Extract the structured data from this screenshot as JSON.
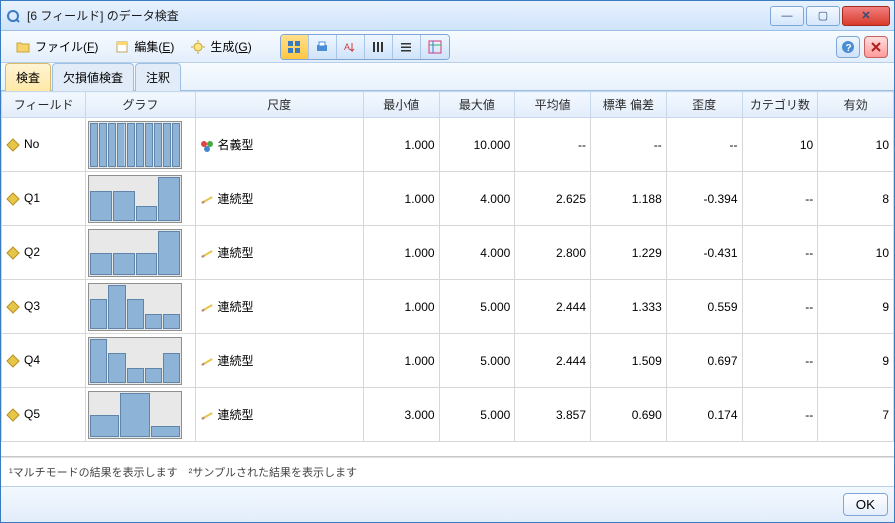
{
  "window": {
    "title": "[6 フィールド] のデータ検査"
  },
  "menu": {
    "file": "ファイル(",
    "file_key": "F",
    "file_end": ")",
    "edit": "編集(",
    "edit_key": "E",
    "edit_end": ")",
    "generate": "生成(",
    "generate_key": "G",
    "generate_end": ")"
  },
  "tabs": {
    "t1": "検査",
    "t2": "欠損値検査",
    "t3": "注釈"
  },
  "columns": {
    "field": "フィールド",
    "graph": "グラフ",
    "measure": "尺度",
    "min": "最小値",
    "max": "最大値",
    "mean": "平均値",
    "sd": "標準 偏差",
    "skew": "歪度",
    "ncat": "カテゴリ数",
    "valid": "有効"
  },
  "measure_labels": {
    "nominal": "名義型",
    "continuous": "連続型"
  },
  "rows": [
    {
      "field": "No",
      "measure": "nominal",
      "min": "1.000",
      "max": "10.000",
      "mean": "--",
      "sd": "--",
      "skew": "--",
      "ncat": "10",
      "valid": "10"
    },
    {
      "field": "Q1",
      "measure": "continuous",
      "min": "1.000",
      "max": "4.000",
      "mean": "2.625",
      "sd": "1.188",
      "skew": "-0.394",
      "ncat": "--",
      "valid": "8"
    },
    {
      "field": "Q2",
      "measure": "continuous",
      "min": "1.000",
      "max": "4.000",
      "mean": "2.800",
      "sd": "1.229",
      "skew": "-0.431",
      "ncat": "--",
      "valid": "10"
    },
    {
      "field": "Q3",
      "measure": "continuous",
      "min": "1.000",
      "max": "5.000",
      "mean": "2.444",
      "sd": "1.333",
      "skew": "0.559",
      "ncat": "--",
      "valid": "9"
    },
    {
      "field": "Q4",
      "measure": "continuous",
      "min": "1.000",
      "max": "5.000",
      "mean": "2.444",
      "sd": "1.509",
      "skew": "0.697",
      "ncat": "--",
      "valid": "9"
    },
    {
      "field": "Q5",
      "measure": "continuous",
      "min": "3.000",
      "max": "5.000",
      "mean": "3.857",
      "sd": "0.690",
      "skew": "0.174",
      "ncat": "--",
      "valid": "7"
    }
  ],
  "chart_data": [
    {
      "type": "bar",
      "field": "No",
      "categories": [
        1,
        2,
        3,
        4,
        5,
        6,
        7,
        8,
        9,
        10
      ],
      "values": [
        1,
        1,
        1,
        1,
        1,
        1,
        1,
        1,
        1,
        1
      ]
    },
    {
      "type": "bar",
      "field": "Q1",
      "categories": [
        1,
        2,
        3,
        4
      ],
      "values": [
        2,
        2,
        1,
        3
      ]
    },
    {
      "type": "bar",
      "field": "Q2",
      "categories": [
        1,
        2,
        3,
        4
      ],
      "values": [
        2,
        2,
        2,
        4
      ]
    },
    {
      "type": "bar",
      "field": "Q3",
      "categories": [
        1,
        2,
        3,
        4,
        5
      ],
      "values": [
        2,
        3,
        2,
        1,
        1
      ]
    },
    {
      "type": "bar",
      "field": "Q4",
      "categories": [
        1,
        2,
        3,
        4,
        5
      ],
      "values": [
        3,
        2,
        1,
        1,
        2
      ]
    },
    {
      "type": "bar",
      "field": "Q5",
      "categories": [
        3,
        4,
        5
      ],
      "values": [
        2,
        4,
        1
      ]
    }
  ],
  "footer": {
    "note": "¹マルチモードの結果を表示します　²サンプルされた結果を表示します",
    "ok": "OK"
  }
}
